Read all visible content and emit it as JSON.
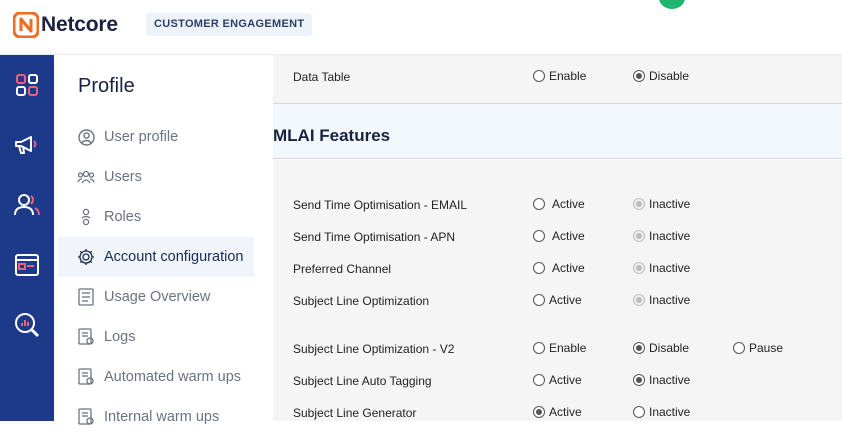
{
  "header": {
    "brand": "Netcore",
    "product_badge": "CUSTOMER ENGAGEMENT"
  },
  "rail": {
    "icons": [
      "dashboard-icon",
      "megaphone-icon",
      "users-icon",
      "browser-window-icon",
      "analytics-search-icon"
    ]
  },
  "sidebar": {
    "title": "Profile",
    "items": [
      {
        "label": "User profile",
        "icon": "user-circle-icon"
      },
      {
        "label": "Users",
        "icon": "users-icon"
      },
      {
        "label": "Roles",
        "icon": "role-icon"
      },
      {
        "label": "Account configuration",
        "icon": "gear-icon"
      },
      {
        "label": "Usage Overview",
        "icon": "document-icon"
      },
      {
        "label": "Logs",
        "icon": "logs-icon"
      },
      {
        "label": "Automated warm ups",
        "icon": "warmup-icon"
      },
      {
        "label": "Internal warm ups",
        "icon": "warmup-icon"
      }
    ],
    "active_index": 3
  },
  "main": {
    "top_row": {
      "name": "Data Table",
      "options": [
        {
          "label": "Enable",
          "selected": false,
          "disabled": false
        },
        {
          "label": "Disable",
          "selected": true,
          "disabled": false
        }
      ]
    },
    "section_title": "MLAI Features",
    "rows": [
      {
        "name": "Send Time Optimisation - EMAIL",
        "options": [
          {
            "label": "Active",
            "selected": false,
            "disabled": false
          },
          {
            "label": "Inactive",
            "selected": true,
            "disabled": true
          }
        ]
      },
      {
        "name": "Send Time Optimisation - APN",
        "options": [
          {
            "label": "Active",
            "selected": false,
            "disabled": false
          },
          {
            "label": "Inactive",
            "selected": true,
            "disabled": true
          }
        ]
      },
      {
        "name": "Preferred Channel",
        "options": [
          {
            "label": "Active",
            "selected": false,
            "disabled": false
          },
          {
            "label": "Inactive",
            "selected": true,
            "disabled": true
          }
        ]
      },
      {
        "name": "Subject Line Optimization",
        "options": [
          {
            "label": "Active",
            "selected": false,
            "disabled": false
          },
          {
            "label": "Inactive",
            "selected": true,
            "disabled": true
          }
        ]
      },
      {
        "name": "Subject Line Optimization - V2",
        "options": [
          {
            "label": "Enable",
            "selected": false,
            "disabled": false
          },
          {
            "label": "Disable",
            "selected": true,
            "disabled": false
          },
          {
            "label": "Pause",
            "selected": false,
            "disabled": false
          }
        ]
      },
      {
        "name": "Subject Line Auto Tagging",
        "options": [
          {
            "label": "Active",
            "selected": false,
            "disabled": false
          },
          {
            "label": "Inactive",
            "selected": true,
            "disabled": false
          }
        ]
      },
      {
        "name": "Subject Line Generator",
        "options": [
          {
            "label": "Active",
            "selected": true,
            "disabled": false
          },
          {
            "label": "Inactive",
            "selected": false,
            "disabled": false
          }
        ]
      }
    ]
  },
  "colors": {
    "rail_bg": "#1d3a8a",
    "logo_orange": "#f26b21",
    "brand_text": "#1b2240",
    "accent_pink": "#f0617a",
    "section_bg": "#f2f8fd",
    "panel_bg": "#f5f5f5"
  }
}
